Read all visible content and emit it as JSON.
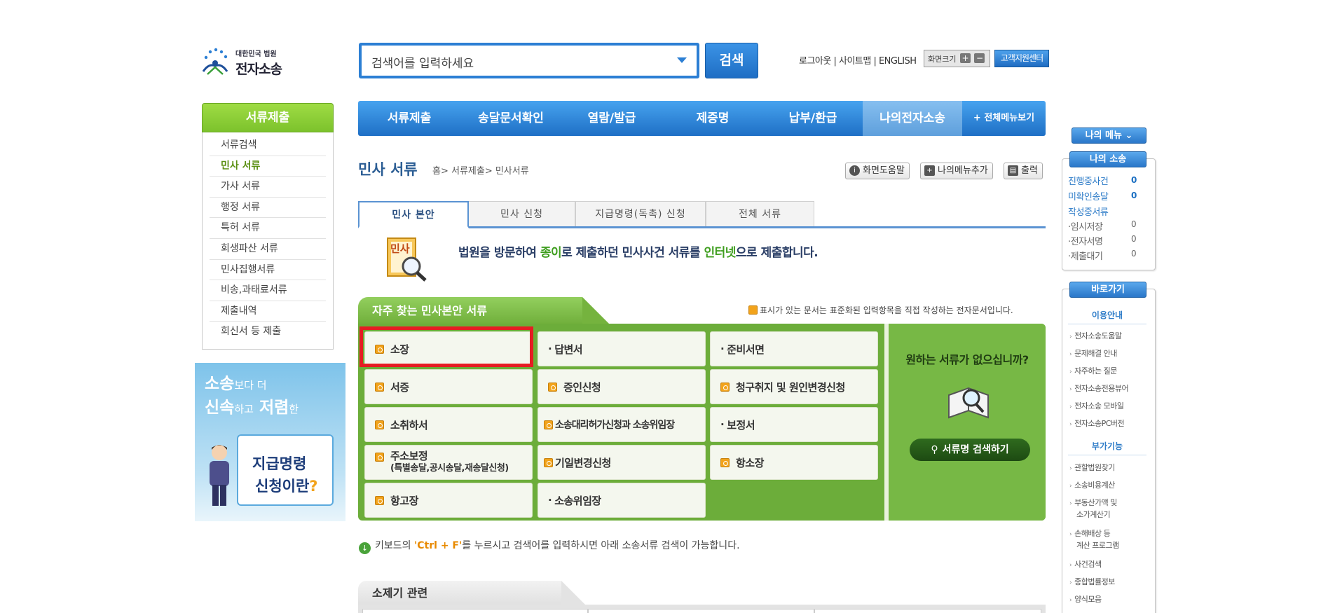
{
  "logo": {
    "small": "대한민국 법원",
    "big": "전자소송"
  },
  "search": {
    "placeholder": "검색어를 입력하세요",
    "button": "검색"
  },
  "util": {
    "links": "로그아웃 | 사이트맵 | ENGLISH",
    "zoom_label": "화면크기",
    "zoom_plus": "+",
    "zoom_minus": "−",
    "help_center": "고객지원센터"
  },
  "sidebar": {
    "title": "서류제출",
    "items": [
      "서류검색",
      "민사 서류",
      "가사 서류",
      "행정 서류",
      "특허 서류",
      "회생파산 서류",
      "민사집행서류",
      "비송,과태료서류",
      "제출내역",
      "회신서 등 제출"
    ]
  },
  "banner": {
    "l1_a": "소송",
    "l1_b": "보다 더",
    "l2_a": "신속",
    "l2_b": "하고",
    "l2_c": "저렴",
    "l2_d": "한",
    "card_1": "지급명령",
    "card_2": "신청이란",
    "card_q": "?"
  },
  "nav": {
    "items": [
      "서류제출",
      "송달문서확인",
      "열람/발급",
      "제증명",
      "납부/환급",
      "나의전자소송"
    ],
    "all": "+ 전체메뉴보기"
  },
  "page": {
    "title": "민사 서류",
    "breadcrumb": "홈> 서류제출> 민사서류",
    "help": "화면도움말",
    "add_menu": "나의메뉴추가",
    "print": "출력"
  },
  "tabs": [
    "민사 본안",
    "민사 신청",
    "지급명령(독촉) 신청",
    "전체 서류"
  ],
  "intro": {
    "icon_label": "민사",
    "t1": "법원을 방문하여 ",
    "g1": "종이",
    "t2": "로 제출하던 민사사건 서류를 ",
    "g2": "인터넷",
    "t3": "으로 제출합니다."
  },
  "freq": {
    "title": "자주 찾는 민사본안 서류",
    "note": "표시가 있는 문서는 표준화된 입력항목을 직접 작성하는 전자문서입니다.",
    "cells": {
      "c1": "소장",
      "c2": "답변서",
      "c3": "준비서면",
      "c4": "서증",
      "c5": "증인신청",
      "c6": "청구취지 및 원인변경신청",
      "c7": "소취하서",
      "c8": "소송대리허가신청과 소송위임장",
      "c9": "보정서",
      "c10a": "주소보정",
      "c10b": "(특별송달,공시송달,재송달신청)",
      "c11": "기일변경신청",
      "c12": "항소장",
      "c13": "항고장",
      "c14": "소송위임장"
    },
    "side_q": "원하는 서류가 없으십니까?",
    "side_btn": "서류명 검색하기"
  },
  "hint": {
    "pre": "키보드의 ",
    "key": "'Ctrl + F'",
    "post": "를 누르시고 검색어를 입력하시면 아래 소송서류 검색이 가능합니다."
  },
  "sub": {
    "title": "소제기 관련"
  },
  "right": {
    "my_menu": "나의 메뉴",
    "my_case": "나의 소송",
    "cases": [
      {
        "label": "진행중사건",
        "count": "0"
      },
      {
        "label": "미확인송달",
        "count": "0"
      }
    ],
    "draft": "작성중서류",
    "drafts": [
      {
        "label": "·임시저장",
        "count": "0"
      },
      {
        "label": "·전자서명",
        "count": "0"
      },
      {
        "label": "·제출대기",
        "count": "0"
      }
    ],
    "shortcut": "바로가기",
    "sec1": "이용안내",
    "links1": [
      "전자소송도움말",
      "문제해결 안내",
      "자주하는 질문",
      "전자소송전용뷰어",
      "전자소송 모바일",
      "전자소송PC버전"
    ],
    "sec2": "부가기능",
    "links2": [
      "관할법원찾기",
      "소송비용계산",
      "부동산가액 및",
      "소가계산기",
      "손해배상 등",
      "계산 프로그램",
      "사건검색",
      "종합법률정보",
      "양식모음"
    ]
  },
  "colors": {
    "blue": "#2c7fd4",
    "green": "#6cad3a",
    "red": "#e51c23",
    "orange": "#f2a31b"
  }
}
